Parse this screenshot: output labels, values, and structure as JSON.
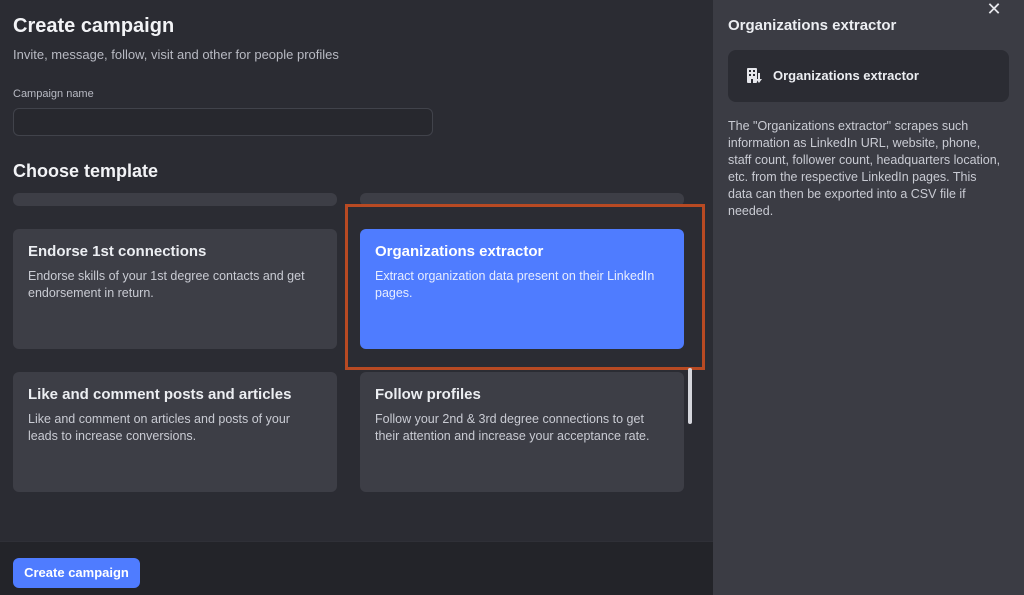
{
  "header": {
    "title": "Create campaign",
    "subtitle": "Invite, message, follow, visit and other for people profiles"
  },
  "campaign_name": {
    "label": "Campaign name",
    "value": "",
    "placeholder": ""
  },
  "templates": {
    "section_title": "Choose template",
    "cards": [
      {
        "title": "Endorse 1st connections",
        "description": "Endorse skills of your 1st degree contacts and get endorsement in return.",
        "selected": false
      },
      {
        "title": "Organizations extractor",
        "description": "Extract organization data present on their LinkedIn pages.",
        "selected": true
      },
      {
        "title": "Like and comment posts and articles",
        "description": "Like and comment on articles and posts of your leads to increase conversions.",
        "selected": false
      },
      {
        "title": "Follow profiles",
        "description": "Follow your 2nd & 3rd degree connections to get their attention and increase your acceptance rate.",
        "selected": false
      }
    ]
  },
  "footer": {
    "create_label": "Create campaign"
  },
  "detail_panel": {
    "title": "Organizations extractor",
    "card_title": "Organizations extractor",
    "icon": "building-download-icon",
    "close_icon": "close-icon",
    "description": "The \"Organizations extractor\" scrapes such information as LinkedIn URL, website, phone, staff count, follower count, headquarters location, etc. from the respective LinkedIn pages. This data can then be exported into a CSV file if needed."
  },
  "colors": {
    "accent": "#4f7cff",
    "highlight_border": "#b84a23",
    "background": "#2b2c33",
    "panel": "#3b3c44"
  }
}
